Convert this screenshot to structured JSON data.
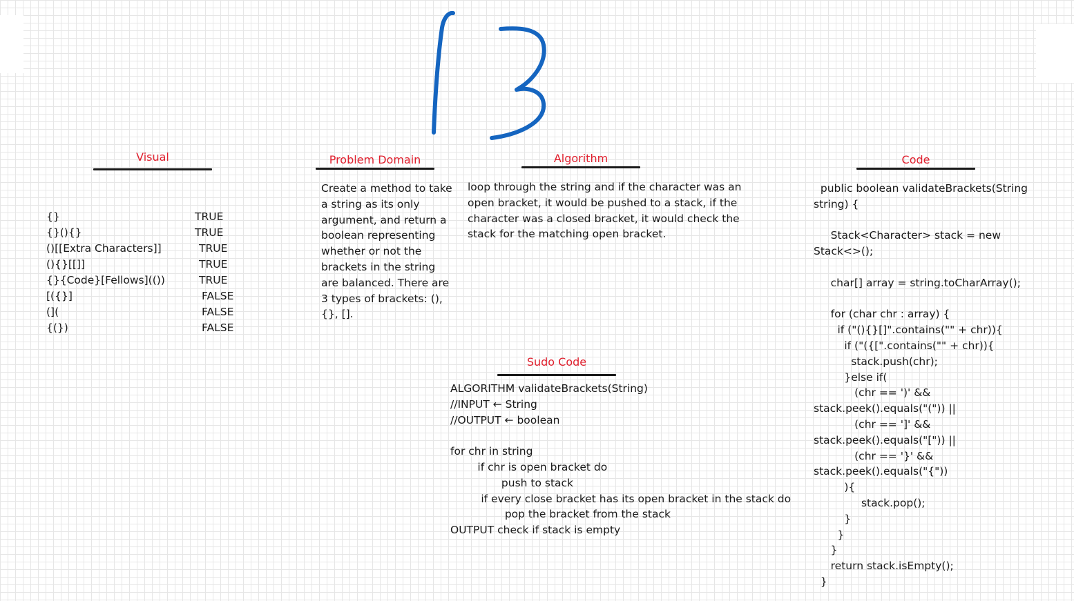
{
  "page_number": "13",
  "colors": {
    "heading": "#e0202e",
    "ink": "#1a1a1a",
    "number_stroke": "#1565c0",
    "grid": "#e6e6e6"
  },
  "visual": {
    "heading": "Visual",
    "rows": [
      {
        "input": "{}",
        "result": "TRUE"
      },
      {
        "input": "{}(){}",
        "result": "TRUE"
      },
      {
        "input": "()[[Extra Characters]]",
        "result": "TRUE"
      },
      {
        "input": "(){}[[]]",
        "result": "TRUE"
      },
      {
        "input": "{}{Code}[Fellows](())",
        "result": "TRUE"
      },
      {
        "input": "[({}]",
        "result": "FALSE"
      },
      {
        "input": "(](",
        "result": "FALSE"
      },
      {
        "input": "{(})",
        "result": "FALSE"
      }
    ]
  },
  "problem_domain": {
    "heading": "Problem Domain",
    "text": "Create a method to take a string as its only argument, and return a boolean representing whether or not the brackets in the string are balanced. There are 3 types of brackets: (), {}, []."
  },
  "algorithm": {
    "heading": "Algorithm",
    "text": " loop through the string and if the character was an open bracket, it would be pushed to a stack, if the character was a closed bracket, it would check the stack for the matching open bracket."
  },
  "sudo_code": {
    "heading": "Sudo Code",
    "lines": [
      "ALGORITHM validateBrackets(String)",
      "//INPUT ← String",
      "//OUTPUT ← boolean",
      "",
      "for chr in string",
      "        if chr is open bracket do",
      "               push to stack",
      "         if every close bracket has its open bracket in the stack do",
      "                pop the bracket from the stack",
      "OUTPUT check if stack is empty"
    ]
  },
  "code": {
    "heading": "Code",
    "lines": [
      "  public boolean validateBrackets(String",
      "string) {",
      "",
      "     Stack<Character> stack = new",
      "Stack<>();",
      "",
      "     char[] array = string.toCharArray();",
      "",
      "     for (char chr : array) {",
      "       if (\"(){}[]\".contains(\"\" + chr)){",
      "         if (\"({[\".contains(\"\" + chr)){",
      "           stack.push(chr);",
      "         }else if(",
      "            (chr == ')' &&",
      "stack.peek().equals(\"(\")) ||",
      "            (chr == ']' &&",
      "stack.peek().equals(\"[\")) ||",
      "            (chr == '}' &&",
      "stack.peek().equals(\"{\"))",
      "         ){",
      "              stack.pop();",
      "         }",
      "       }",
      "     }",
      "     return stack.isEmpty();",
      "  }"
    ]
  }
}
